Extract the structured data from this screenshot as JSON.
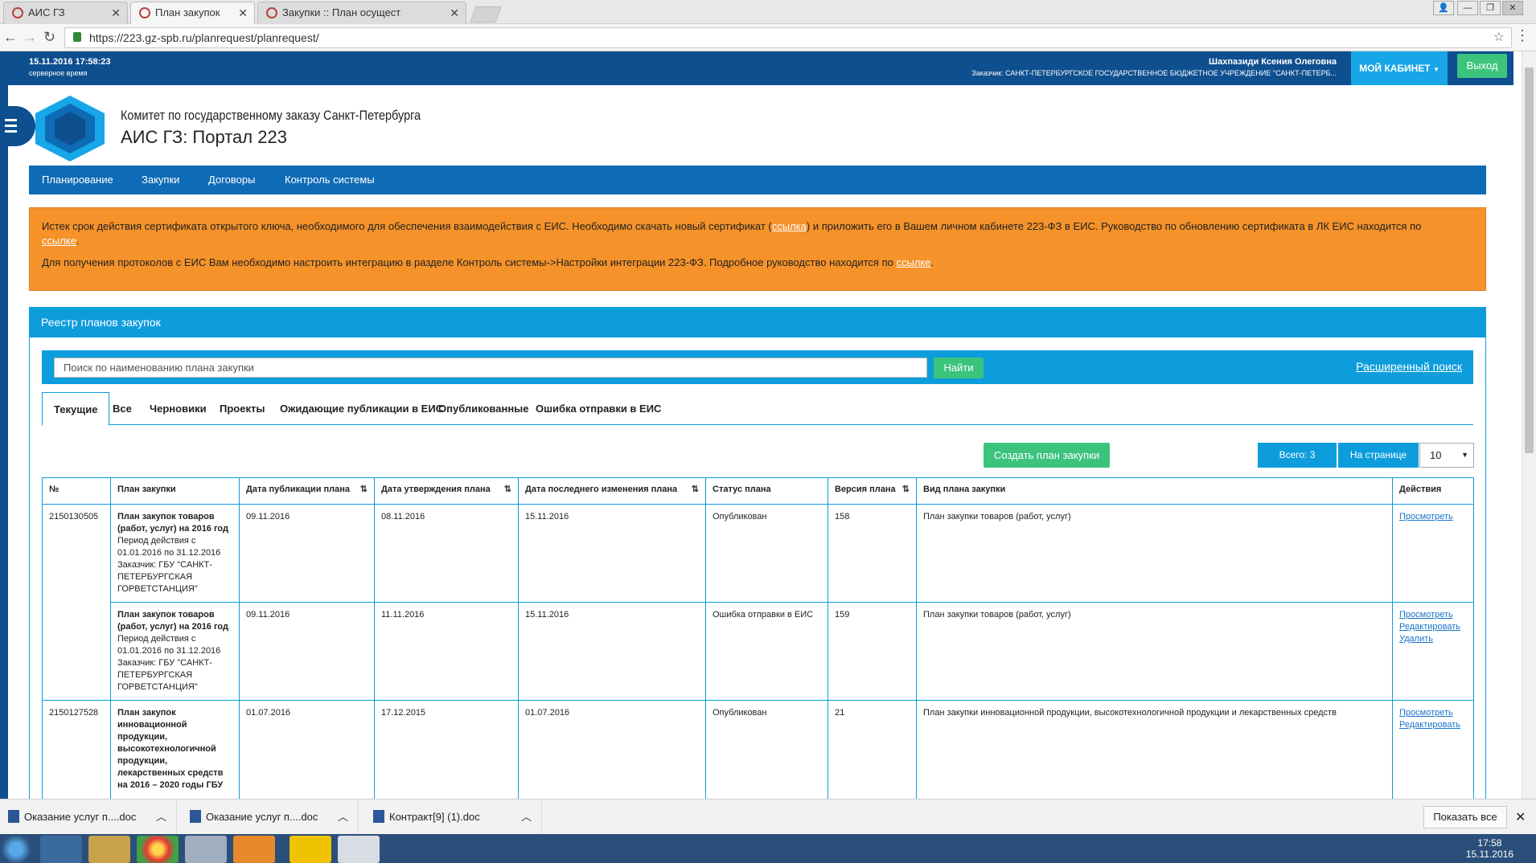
{
  "browser": {
    "tabs": [
      {
        "title": "АИС ГЗ"
      },
      {
        "title": "План закупок"
      },
      {
        "title": "Закупки :: План осущест"
      }
    ],
    "url": "https://223.gz-spb.ru/planrequest/planrequest/"
  },
  "topbar": {
    "datetime": "15.11.2016 17:58:23",
    "datetime_note": "серверное время",
    "user_name": "Шахпазиди Ксения Олеговна",
    "customer": "Заказчик: САНКТ-ПЕТЕРБУРГСКОЕ ГОСУДАРСТВЕННОЕ БЮДЖЕТНОЕ УЧРЕЖДЕНИЕ \"САНКТ-ПЕТЕРБ...",
    "cabinet_label": "МОЙ КАБИНЕТ",
    "logout_label": "Выход"
  },
  "header": {
    "org": "Комитет по государственному заказу Санкт-Петербурга",
    "portal": "АИС ГЗ: Портал 223"
  },
  "mainnav": [
    "Планирование",
    "Закупки",
    "Договоры",
    "Контроль системы"
  ],
  "alert": {
    "line1_a": "Истек срок действия сертификата открытого ключа, необходимого для обеспечения взаимодействия с ЕИС. Необходимо скачать новый сертификат (",
    "line1_link": "ссылка",
    "line1_b": ") и приложить его в Вашем личном кабинете 223-ФЗ в ЕИС. Руководство по обновлению сертификата в ЛК ЕИС находится по",
    "line1_link2": "ссылке",
    "line1_c": ".",
    "line2_a": "Для получения протоколов с ЕИС Вам необходимо настроить интеграцию в разделе Контроль системы->Настройки интеграции 223-ФЗ. Подробное руководство находится по ",
    "line2_link": "ссылке",
    "line2_b": "."
  },
  "registry": {
    "title": "Реестр планов закупок",
    "search_placeholder": "Поиск по наименованию плана закупки",
    "find_label": "Найти",
    "advanced_label": "Расширенный поиск",
    "tabs": [
      "Текущие",
      "Все",
      "Черновики",
      "Проекты",
      "Ожидающие публикации в ЕИС",
      "Опубликованные",
      "Ошибка отправки в ЕИС"
    ],
    "create_label": "Создать план закупки",
    "total_label": "Всего: 3",
    "perpage_label": "На странице",
    "perpage_value": "10",
    "columns": [
      "№",
      "План закупки",
      "Дата публикации плана",
      "Дата утверждения плана",
      "Дата последнего изменения плана",
      "Статус плана",
      "Версия плана",
      "Вид плана закупки",
      "Действия"
    ],
    "rows": [
      {
        "num": "2150130505",
        "plan_title": "План закупок товаров (работ, услуг) на 2016 год",
        "plan_period": "Период действия с 01.01.2016 по 31.12.2016",
        "plan_customer": "Заказчик: ГБУ \"САНКТ-ПЕТЕРБУРГСКАЯ ГОРВЕТСТАНЦИЯ\"",
        "pub_date": "09.11.2016",
        "appr_date": "08.11.2016",
        "mod_date": "15.11.2016",
        "status": "Опубликован",
        "version": "158",
        "kind": "План закупки товаров (работ, услуг)",
        "actions": [
          "Просмотреть"
        ]
      },
      {
        "num": "",
        "plan_title": "План закупок товаров (работ, услуг) на 2016 год",
        "plan_period": "Период действия с 01.01.2016 по 31.12.2016",
        "plan_customer": "Заказчик: ГБУ \"САНКТ-ПЕТЕРБУРГСКАЯ ГОРВЕТСТАНЦИЯ\"",
        "pub_date": "09.11.2016",
        "appr_date": "11.11.2016",
        "mod_date": "15.11.2016",
        "status": "Ошибка отправки в ЕИС",
        "version": "159",
        "kind": "План закупки товаров (работ, услуг)",
        "actions": [
          "Просмотреть",
          "Редактировать",
          "Удалить"
        ]
      },
      {
        "num": "2150127528",
        "plan_title": "План закупок инновационной продукции, высокотехнологичной продукции, лекарственных средств на 2016 – 2020 годы ГБУ",
        "plan_period": "",
        "plan_customer": "",
        "pub_date": "01.07.2016",
        "appr_date": "17.12.2015",
        "mod_date": "01.07.2016",
        "status": "Опубликован",
        "version": "21",
        "kind": "План закупки инновационной продукции, высокотехнологичной продукции и лекарственных средств",
        "actions": [
          "Просмотреть",
          "Редактировать"
        ]
      }
    ]
  },
  "downloads": {
    "items": [
      "Оказание услуг п....doc",
      "Оказание услуг п....doc",
      "Контракт[9] (1).doc"
    ],
    "show_all": "Показать все"
  },
  "taskbar": {
    "time": "17:58",
    "date": "15.11.2016"
  }
}
